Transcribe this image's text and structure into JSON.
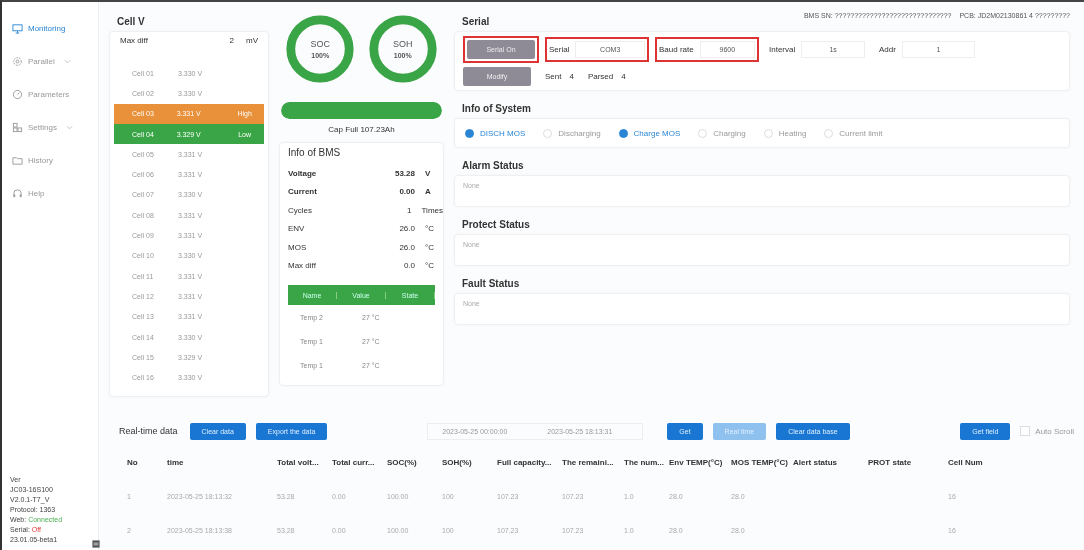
{
  "sidebar": {
    "items": [
      {
        "label": "Monitoring",
        "selected": true,
        "expandable": false
      },
      {
        "label": "Parallel",
        "selected": false,
        "expandable": true
      },
      {
        "label": "Parameters",
        "selected": false,
        "expandable": false
      },
      {
        "label": "Settings",
        "selected": false,
        "expandable": true
      },
      {
        "label": "History",
        "selected": false,
        "expandable": false
      },
      {
        "label": "Help",
        "selected": false,
        "expandable": false
      }
    ],
    "footer": [
      {
        "label": "Ver"
      },
      {
        "label": "JC03-16S100"
      },
      {
        "label": "V2.0.1-T7_V"
      },
      {
        "label": "Protocol: 1363"
      },
      {
        "label": "Web:",
        "value": "Connected",
        "ok": true
      },
      {
        "label": "Serial:",
        "value": "Off",
        "ok": false
      },
      {
        "label": "23.01.05-beta1"
      }
    ]
  },
  "cells": {
    "title": "Cell V",
    "max_diff_label": "Max diff",
    "max_diff": "2",
    "max_diff_unit": "mV",
    "rows": [
      {
        "name": "Cell 01",
        "voltage": "3.330 V"
      },
      {
        "name": "Cell 02",
        "voltage": "3.330 V"
      },
      {
        "name": "Cell 03",
        "voltage": "3.331 V",
        "flag": "High",
        "color": "#e8903a"
      },
      {
        "name": "Cell 04",
        "voltage": "3.329 V",
        "flag": "Low",
        "color": "#3aa546"
      },
      {
        "name": "Cell 05",
        "voltage": "3.331 V"
      },
      {
        "name": "Cell 06",
        "voltage": "3.331 V"
      },
      {
        "name": "Cell 07",
        "voltage": "3.330 V"
      },
      {
        "name": "Cell 08",
        "voltage": "3.331 V"
      },
      {
        "name": "Cell 09",
        "voltage": "3.331 V"
      },
      {
        "name": "Cell 10",
        "voltage": "3.330 V"
      },
      {
        "name": "Cell 11",
        "voltage": "3.331 V"
      },
      {
        "name": "Cell 12",
        "voltage": "3.331 V"
      },
      {
        "name": "Cell 13",
        "voltage": "3.331 V"
      },
      {
        "name": "Cell 14",
        "voltage": "3.330 V"
      },
      {
        "name": "Cell 15",
        "voltage": "3.329 V"
      },
      {
        "name": "Cell 16",
        "voltage": "3.330 V"
      }
    ]
  },
  "gauges": [
    {
      "label": "SOC",
      "value": "100%",
      "level": 1
    },
    {
      "label": "SOH",
      "value": "100%",
      "level": 1
    }
  ],
  "capacity": {
    "level": 1,
    "label": "Cap Full",
    "value": "107.23Ah"
  },
  "bms": {
    "title": "Info of BMS",
    "rows": [
      {
        "label": "Voltage",
        "value": "53.28",
        "unit": "V",
        "bold": true
      },
      {
        "label": "Current",
        "value": "0.00",
        "unit": "A",
        "bold": true
      },
      {
        "label": "Cycles",
        "value": "1",
        "unit": "Times",
        "bold": false
      },
      {
        "label": "ENV",
        "value": "26.0",
        "unit": "°C",
        "bold": false
      },
      {
        "label": "MOS",
        "value": "26.0",
        "unit": "°C",
        "bold": false
      },
      {
        "label": "Max diff",
        "value": "0.0",
        "unit": "°C",
        "bold": false
      }
    ],
    "temp_header": [
      "Name",
      "Value",
      "State"
    ],
    "temps": [
      {
        "name": "Temp 2",
        "value": "27 °C"
      },
      {
        "name": "Temp 1",
        "value": "27 °C"
      },
      {
        "name": "Temp 1",
        "value": "27 °C"
      }
    ]
  },
  "serial": {
    "title": "Serial",
    "bms_sn_label": "BMS SN:",
    "bms_sn": "??????????????????????????????",
    "pcb_label": "PCB:",
    "pcb": "JD2M02130861 4 ?????????",
    "open_button": {
      "label": "Serial On",
      "highlighted": true
    },
    "port": {
      "label": "Serial",
      "value": "COM3",
      "highlighted": true
    },
    "baud": {
      "label": "Baud rate",
      "value": "9600",
      "highlighted": true
    },
    "interval": {
      "label": "Interval",
      "value": "1s"
    },
    "addr": {
      "label": "Addr",
      "value": "1"
    },
    "modify_button": "Modify",
    "sent_label": "Sent",
    "sent": "4",
    "parsed_label": "Parsed",
    "parsed": "4"
  },
  "system": {
    "title": "Info of System",
    "flags": [
      {
        "label": "DISCH MOS",
        "on": true
      },
      {
        "label": "Discharging",
        "on": false
      },
      {
        "label": "Charge MOS",
        "on": true
      },
      {
        "label": "Charging",
        "on": false
      },
      {
        "label": "Heating",
        "on": false
      },
      {
        "label": "Current limit",
        "on": false
      }
    ]
  },
  "statuses": [
    {
      "title": "Alarm Status",
      "text": "None"
    },
    {
      "title": "Protect Status",
      "text": "None"
    },
    {
      "title": "Fault Status",
      "text": "None"
    }
  ],
  "realtime": {
    "title": "Real-time data",
    "clear_button": "Clear data",
    "export_button": "Export the data",
    "start": "2023-05-25 00:00:00",
    "end": "2023-05-25 18:13:31",
    "buttons": [
      {
        "label": "Get",
        "disabled": false
      },
      {
        "label": "Real time",
        "disabled": true
      },
      {
        "label": "Clear data base",
        "disabled": false
      }
    ],
    "field_button": "Get field",
    "auto_scroll": {
      "label": "Auto Scroll",
      "checked": false
    },
    "columns": [
      "No",
      "time",
      "Total volt...",
      "Total curr...",
      "SOC(%)",
      "SOH(%)",
      "Full capacity...",
      "The remaini...",
      "The num...",
      "Env TEMP(°C)",
      "MOS TEMP(°C)",
      "Alert status",
      "PROT state",
      "Cell Num"
    ],
    "rows": [
      {
        "cells": [
          "1",
          "2023-05-25 18:13:32",
          "53.28",
          "0.00",
          "100.00",
          "100",
          "107.23",
          "107.23",
          "1.0",
          "28.0",
          "28.0",
          null,
          null,
          "16"
        ]
      },
      {
        "cells": [
          "2",
          "2023-05-25 18:13:38",
          "53.28",
          "0.00",
          "100.00",
          "100",
          "107.23",
          "107.23",
          "1.0",
          "28.0",
          "28.0",
          null,
          null,
          "16"
        ]
      }
    ]
  }
}
